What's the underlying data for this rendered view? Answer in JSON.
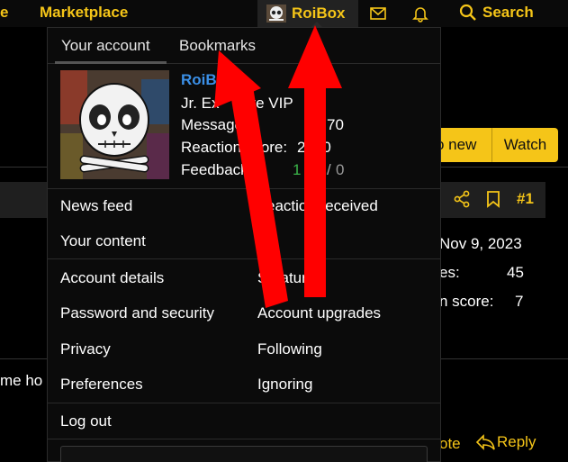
{
  "nav": {
    "left_partial": "e",
    "marketplace": "Marketplace",
    "username": "RoiBox",
    "search": "Search"
  },
  "background": {
    "btn_new": "o new",
    "btn_watch": "Watch",
    "post_number": "#1",
    "joined": "Nov 9, 2023",
    "stat1_label": "es:",
    "stat1_value": "45",
    "stat2_label": "n score:",
    "stat2_value": "7",
    "snippet": "me ho",
    "quote": "ote",
    "reply": "Reply"
  },
  "menu": {
    "tabs": [
      "Your account",
      "Bookmarks"
    ],
    "profile": {
      "name": "RoiBo",
      "title": "Jr. Ex      ive VIP",
      "messages_label": "Message",
      "messages_value": "70",
      "reactions_label": "Reaction score:",
      "reactions_value": "2  40",
      "feedback_label": "Feedback",
      "feedback_pos": "1",
      "feedback_neg": "0"
    },
    "items_row1": {
      "left": "News feed",
      "right": "eactio   received"
    },
    "items_row2": {
      "left": "Your content"
    },
    "items_grid": [
      {
        "left": "Account details",
        "right": "S   ature"
      },
      {
        "left": "Password and security",
        "right": "Account upgrades"
      },
      {
        "left": "Privacy",
        "right": "Following"
      },
      {
        "left": "Preferences",
        "right": "Ignoring"
      }
    ],
    "logout": "Log out"
  },
  "colors": {
    "accent": "#f5c518",
    "username_blue": "#3b8fe6",
    "feedback_green": "#3bb54a",
    "arrow_red": "#ff0000"
  },
  "icons": {
    "mail": "mail-icon",
    "bell": "bell-icon",
    "search": "search-icon",
    "share": "share-icon",
    "bookmark": "bookmark-icon",
    "reply": "reply-icon"
  }
}
